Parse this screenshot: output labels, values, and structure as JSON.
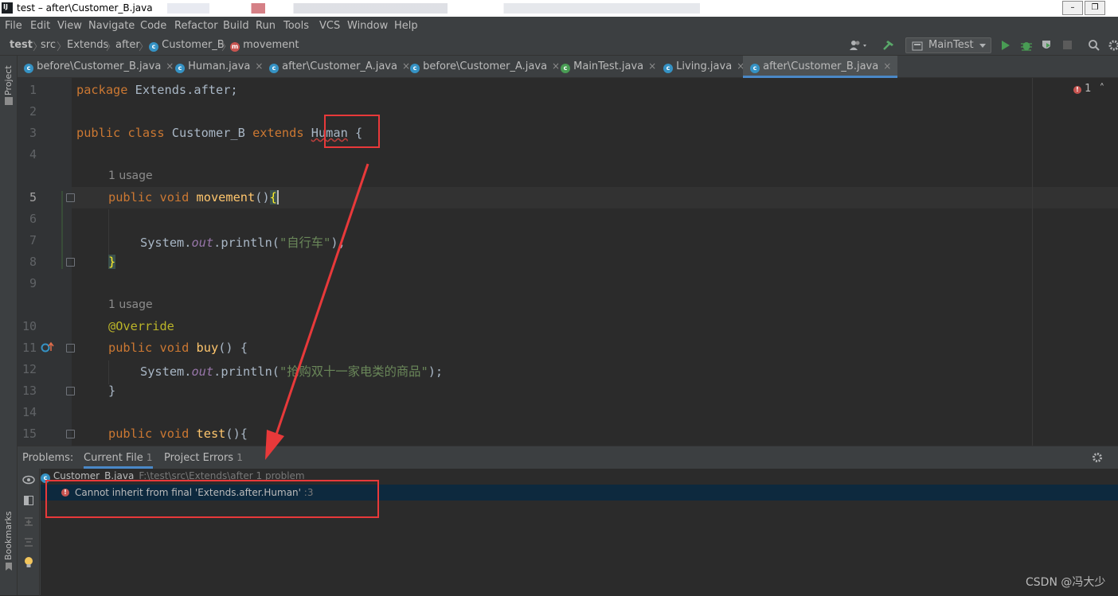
{
  "window": {
    "title": "test – after\\Customer_B.java"
  },
  "menu": [
    "File",
    "Edit",
    "View",
    "Navigate",
    "Code",
    "Refactor",
    "Build",
    "Run",
    "Tools",
    "VCS",
    "Window",
    "Help"
  ],
  "breadcrumb": [
    "test",
    "src",
    "Extends",
    "after",
    "Customer_B",
    "movement"
  ],
  "run_config": "MainTest",
  "tabs": [
    "before\\Customer_B.java",
    "Human.java",
    "after\\Customer_A.java",
    "before\\Customer_A.java",
    "MainTest.java",
    "Living.java",
    "after\\Customer_B.java"
  ],
  "side": {
    "project": "Project",
    "bookmarks": "Bookmarks"
  },
  "editor": {
    "error_count": "1",
    "line_numbers": [
      "1",
      "2",
      "3",
      "4",
      "5",
      "6",
      "7",
      "8",
      "9",
      "10",
      "11",
      "12",
      "13",
      "14",
      "15"
    ],
    "usage_hint": "1 usage",
    "code": {
      "l1_kw": "package",
      "l1_rest": " Extends.after;",
      "l3_kw1": "public",
      "l3_kw2": "class",
      "l3_name": " Customer_B ",
      "l3_kw3": "extends",
      "l3_human": "Human",
      "l3_brace": " {",
      "l5_kw1": "public",
      "l5_kw2": "void",
      "l5_meth": "movement",
      "l5_rest": "()",
      "l5_brace": "{",
      "l7_a": "System.",
      "l7_out": "out",
      "l7_b": ".println(",
      "l7_str": "\"自行车\"",
      "l7_c": ");",
      "l8": "}",
      "l10": "@Override",
      "l11_kw1": "public",
      "l11_kw2": "void",
      "l11_meth": "buy",
      "l11_rest": "() {",
      "l12_a": "System.",
      "l12_out": "out",
      "l12_b": ".println(",
      "l12_str": "\"抢购双十一家电类的商品\"",
      "l12_c": ");",
      "l13": "}",
      "l15_kw1": "public",
      "l15_kw2": "void",
      "l15_meth": "test",
      "l15_rest": "(){"
    }
  },
  "problems": {
    "label": "Problems:",
    "tab_current": "Current File",
    "tab_current_count": "1",
    "tab_project": "Project Errors",
    "tab_project_count": "1",
    "file": "Customer_B.java",
    "file_path": "F:\\test\\src\\Extends\\after  1 problem",
    "error_msg": "Cannot inherit from final 'Extends.after.Human'",
    "error_line": ":3"
  },
  "watermark": "CSDN @冯大少",
  "colors": {
    "annotation_red": "#e8393a",
    "active_tab_underline": "#4a88c7"
  }
}
